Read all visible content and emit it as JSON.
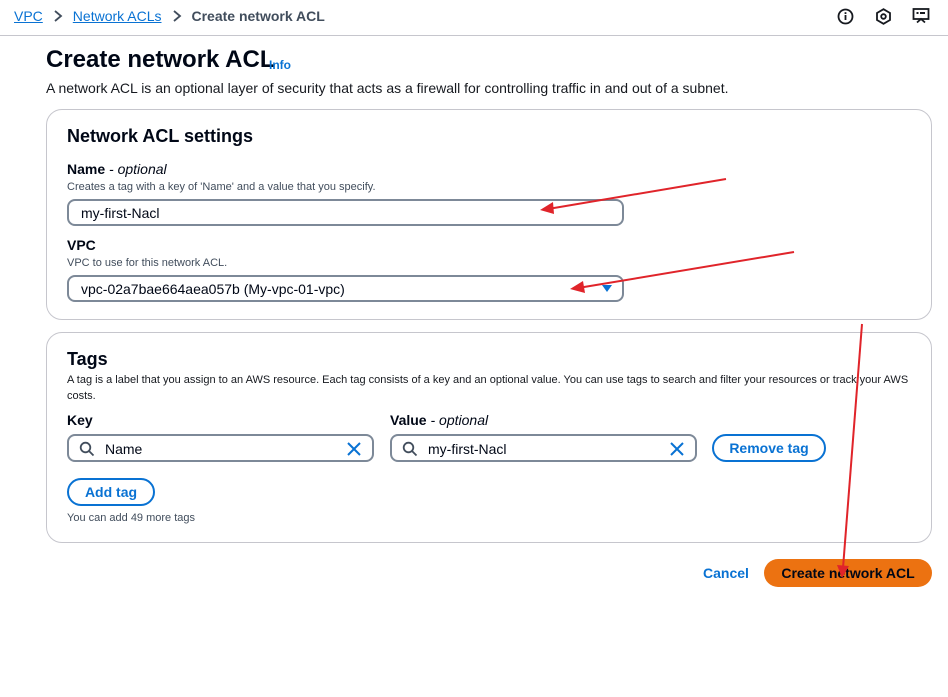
{
  "breadcrumb": {
    "items": [
      "VPC",
      "Network ACLs"
    ],
    "current": "Create network ACL"
  },
  "header": {
    "icons": [
      "info-circle-icon",
      "hexagon-settings-icon",
      "console-feedback-icon"
    ]
  },
  "page": {
    "title": "Create network ACL",
    "info_label": "Info",
    "description": "A network ACL is an optional layer of security that acts as a firewall for controlling traffic in and out of a subnet."
  },
  "settings": {
    "heading": "Network ACL settings",
    "name_label": "Name",
    "name_optional": "optional",
    "name_hint": "Creates a tag with a key of 'Name' and a value that you specify.",
    "name_value": "my-first-Nacl",
    "vpc_label": "VPC",
    "vpc_hint": "VPC to use for this network ACL.",
    "vpc_value": "vpc-02a7bae664aea057b (My-vpc-01-vpc)"
  },
  "tags": {
    "heading": "Tags",
    "description": "A tag is a label that you assign to an AWS resource. Each tag consists of a key and an optional value. You can use tags to search and filter your resources or track your AWS costs.",
    "key_label": "Key",
    "value_label": "Value",
    "value_optional": "optional",
    "rows": [
      {
        "key": "Name",
        "value": "my-first-Nacl"
      }
    ],
    "remove_label": "Remove tag",
    "add_label": "Add tag",
    "remaining": "You can add 49 more tags"
  },
  "footer": {
    "cancel_label": "Cancel",
    "submit_label": "Create network ACL"
  },
  "colors": {
    "link": "#0972d3",
    "primary_button": "#ec7211",
    "annotation_arrow": "#e0242a"
  }
}
